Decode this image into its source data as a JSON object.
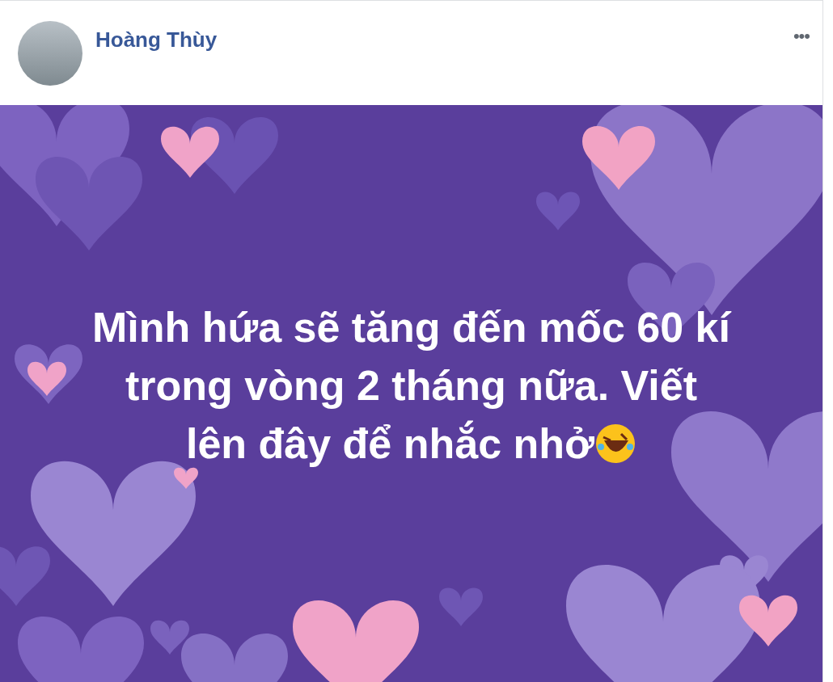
{
  "post": {
    "author": "Hoàng Thùy",
    "more": "•••",
    "text_lines": [
      "Mình hứa sẽ tăng đến mốc 60 kí",
      "trong vòng 2 tháng nữa. Viết",
      "lên đây để nhắc nhở"
    ]
  }
}
